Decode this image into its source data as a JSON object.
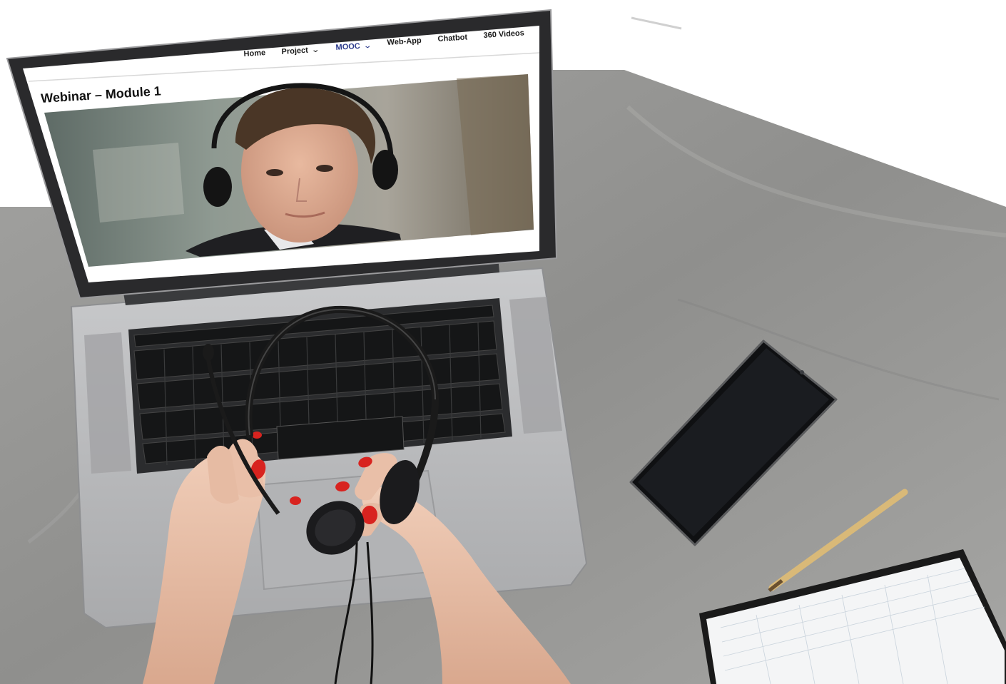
{
  "website": {
    "nav": [
      {
        "label": "Home",
        "active": false,
        "has_dropdown": false
      },
      {
        "label": "Project",
        "active": false,
        "has_dropdown": true
      },
      {
        "label": "MOOC",
        "active": true,
        "has_dropdown": true
      },
      {
        "label": "Web-App",
        "active": false,
        "has_dropdown": false
      },
      {
        "label": "Chatbot",
        "active": false,
        "has_dropdown": false
      },
      {
        "label": "360 Videos",
        "active": false,
        "has_dropdown": false
      }
    ],
    "page_title": "Webinar – Module 1",
    "active_color": "#2b3a8c"
  },
  "scene": {
    "desk_color": "#9a9a98",
    "laptop_color": "#b9babc",
    "nail_color": "#d8231f"
  }
}
